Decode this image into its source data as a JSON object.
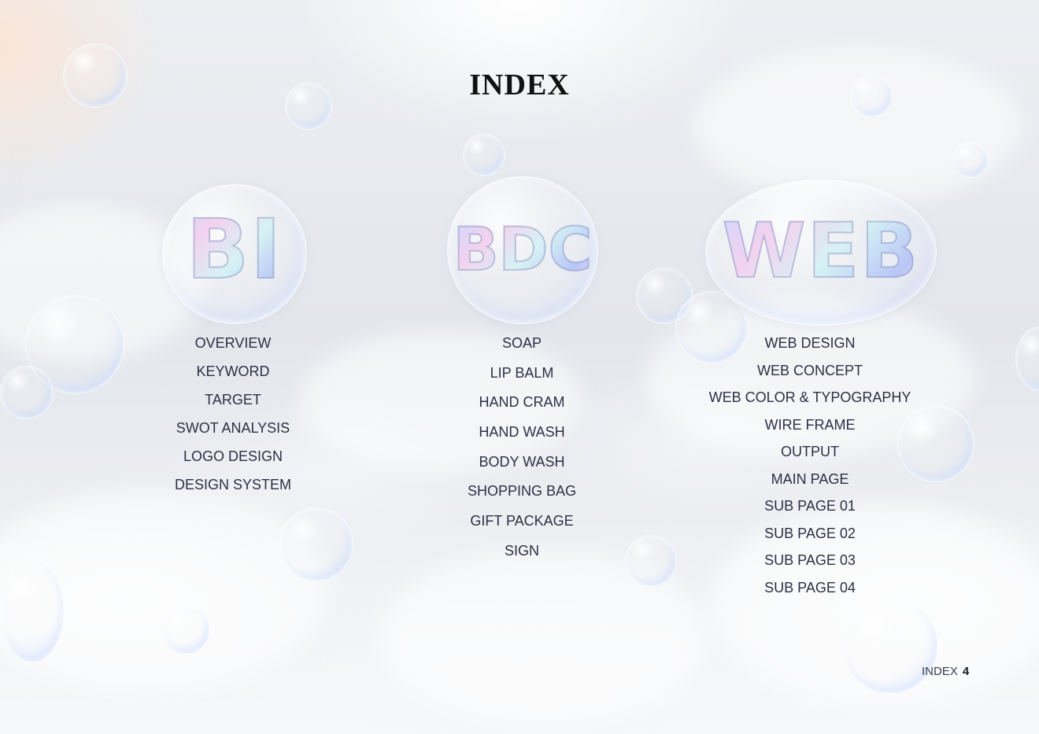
{
  "page": {
    "title": "INDEX"
  },
  "sections": [
    {
      "logo": "BI",
      "items": [
        "OVERVIEW",
        "KEYWORD",
        "TARGET",
        "SWOT ANALYSIS",
        "LOGO DESIGN",
        "DESIGN SYSTEM"
      ]
    },
    {
      "logo": "BDC",
      "items": [
        "SOAP",
        "LIP BALM",
        "HAND CRAM",
        "HAND WASH",
        "BODY WASH",
        "SHOPPING BAG",
        "GIFT PACKAGE",
        "SIGN"
      ]
    },
    {
      "logo": "WEB",
      "items": [
        "WEB DESIGN",
        "WEB CONCEPT",
        "WEB COLOR & TYPOGRAPHY",
        "WIRE FRAME",
        "OUTPUT",
        "MAIN PAGE",
        "SUB PAGE 01",
        "SUB PAGE 02",
        "SUB PAGE 03",
        "SUB PAGE 04"
      ]
    }
  ],
  "footer": {
    "label": "INDEX",
    "page_number": "4"
  }
}
